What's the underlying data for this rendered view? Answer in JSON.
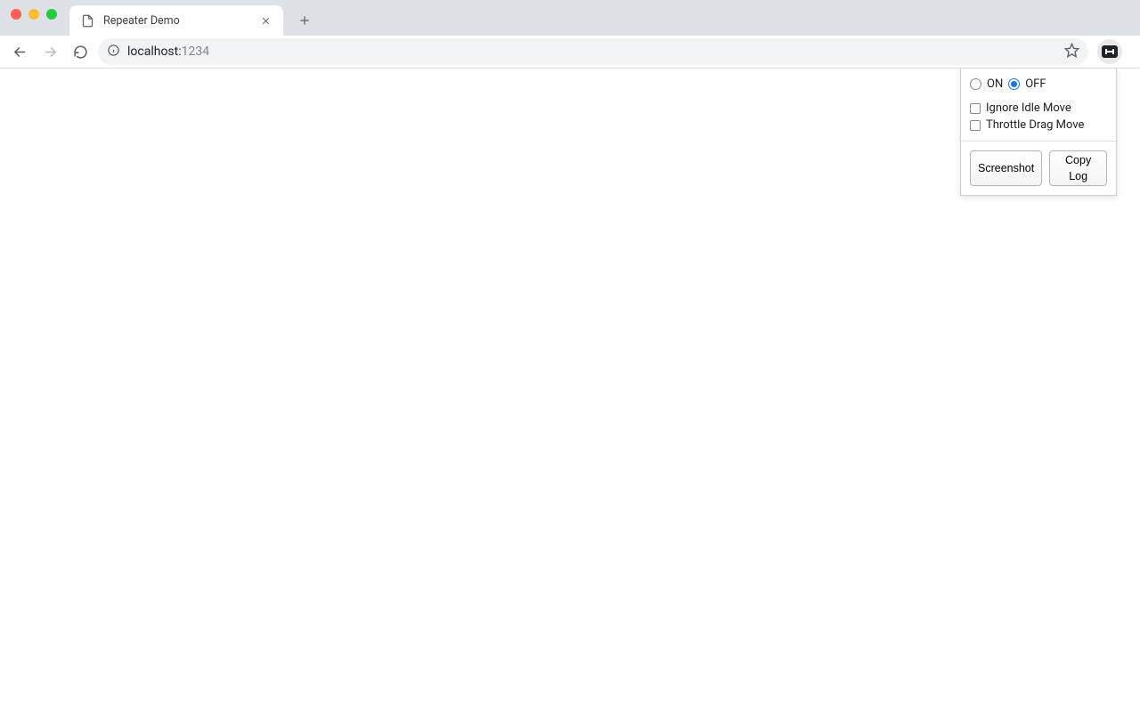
{
  "browser": {
    "tab_title": "Repeater Demo",
    "url_host": "localhost:",
    "url_port": "1234"
  },
  "popup": {
    "toggle": {
      "on_label": "ON",
      "off_label": "OFF",
      "selected": "off"
    },
    "options": {
      "ignore_idle_move": {
        "label": "Ignore Idle Move",
        "checked": false
      },
      "throttle_drag_move": {
        "label": "Throttle Drag Move",
        "checked": false
      }
    },
    "buttons": {
      "screenshot": "Screenshot",
      "copy_log": "Copy Log"
    }
  }
}
